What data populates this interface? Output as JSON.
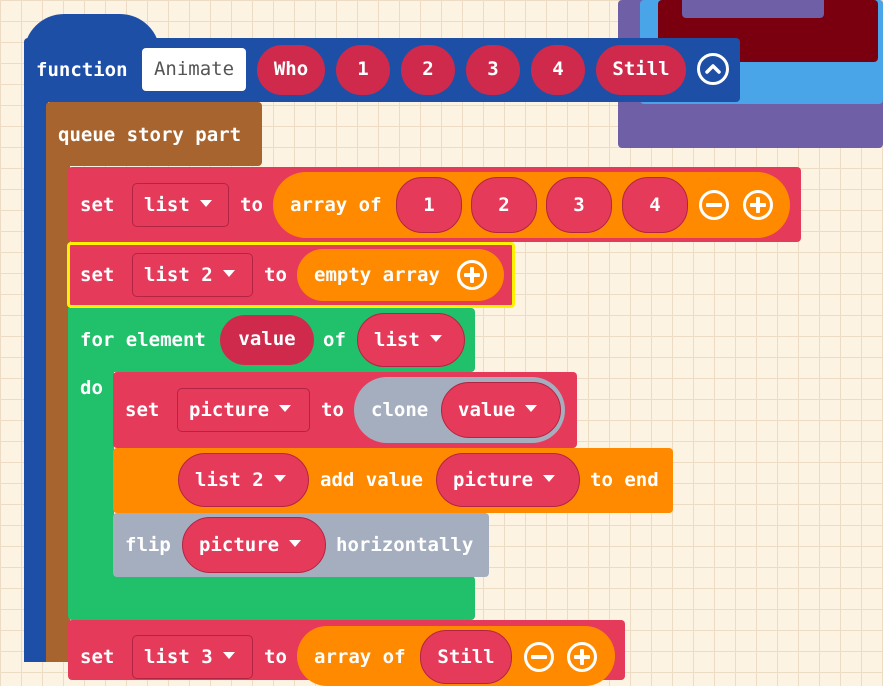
{
  "function_block": {
    "keyword": "function",
    "name": "Animate",
    "params": [
      "Who",
      "1",
      "2",
      "3",
      "4",
      "Still"
    ]
  },
  "queue_block": {
    "label": "queue story part"
  },
  "set_list": {
    "set": "set",
    "variable": "list",
    "to": "to",
    "array_label": "array of",
    "items": [
      "1",
      "2",
      "3",
      "4"
    ]
  },
  "set_list2": {
    "set": "set",
    "variable": "list 2",
    "to": "to",
    "value": "empty array"
  },
  "for_block": {
    "for_label": "for element",
    "element": "value",
    "of": "of",
    "list": "list",
    "do": "do"
  },
  "set_picture": {
    "set": "set",
    "variable": "picture",
    "to": "to",
    "clone": "clone",
    "clone_arg": "value"
  },
  "add_block": {
    "list": "list 2",
    "add": "add value",
    "value": "picture",
    "suffix": "to end"
  },
  "flip_block": {
    "flip": "flip",
    "variable": "picture",
    "suffix": "horizontally"
  },
  "set_list3": {
    "set": "set",
    "variable": "list 3",
    "to": "to",
    "array_label": "array of",
    "items": [
      "Still"
    ]
  },
  "colors": {
    "function": "#1e4fa6",
    "queue": "#a8642f",
    "variables": "#e63a5a",
    "arrays": "#ff8a00",
    "loops": "#21c06a",
    "images": "#a5aebf",
    "selected_outline": "#fff200"
  }
}
